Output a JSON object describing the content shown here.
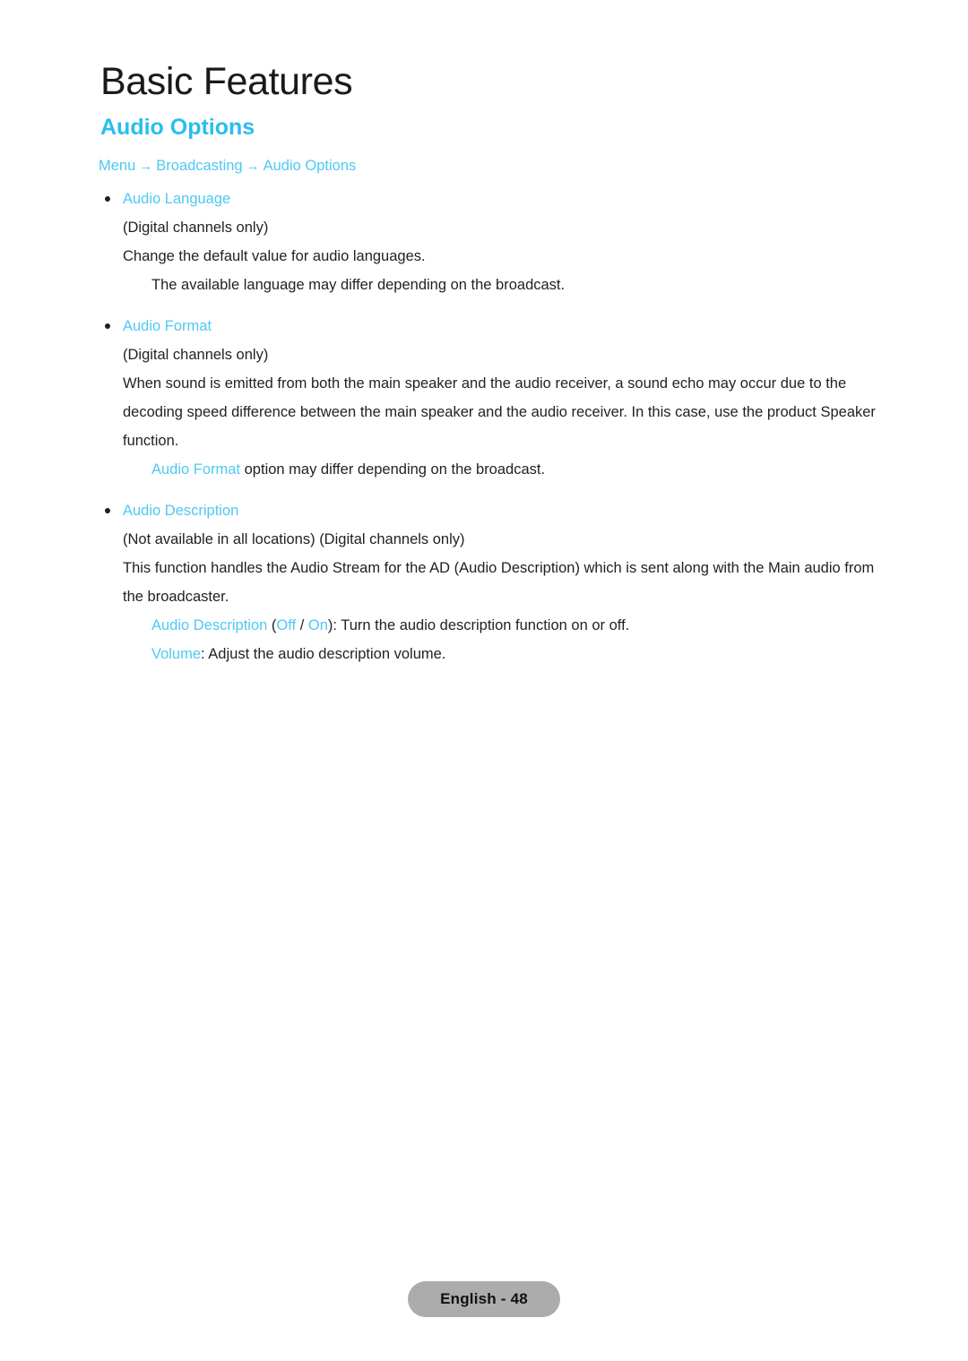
{
  "page": {
    "chapter_title": "Basic Features",
    "section_title": "Audio Options"
  },
  "breadcrumb": {
    "items": [
      "Menu",
      "Broadcasting",
      "Audio Options"
    ],
    "separator": "→"
  },
  "sections": [
    {
      "heading": "Audio Language",
      "lines": [
        {
          "style": "para",
          "text": "(Digital channels only)"
        },
        {
          "style": "para",
          "text": "Change the default value for audio languages."
        },
        {
          "style": "note",
          "text": "The available language may differ depending on the broadcast."
        }
      ]
    },
    {
      "heading": "Audio Format",
      "lines": [
        {
          "style": "para",
          "text": "(Digital channels only)"
        },
        {
          "style": "para",
          "text": "When sound is emitted from both the main speaker and the audio receiver, a sound echo may occur due to the decoding speed difference between the main speaker and the audio receiver. In this case, use the product Speaker function."
        },
        {
          "style": "note",
          "rich": true,
          "parts": [
            {
              "text": "Audio Format",
              "color": "cyan"
            },
            {
              "text": " option may differ depending on the broadcast.",
              "color": "dark"
            }
          ]
        }
      ]
    },
    {
      "heading": "Audio Description",
      "lines": [
        {
          "style": "para",
          "text": "(Not available in all locations) (Digital channels only)"
        },
        {
          "style": "para",
          "text": "This function handles the Audio Stream for the AD (Audio Description) which is sent along with the Main audio from the broadcaster."
        },
        {
          "style": "note",
          "rich": true,
          "parts": [
            {
              "text": "Audio Description",
              "color": "cyan"
            },
            {
              "text": " (",
              "color": "dark"
            },
            {
              "text": "Off",
              "color": "cyan"
            },
            {
              "text": " / ",
              "color": "dark"
            },
            {
              "text": "On",
              "color": "cyan"
            },
            {
              "text": "): Turn the audio description function on or off.",
              "color": "dark"
            }
          ]
        },
        {
          "style": "note",
          "rich": true,
          "parts": [
            {
              "text": "Volume",
              "color": "cyan"
            },
            {
              "text": ": Adjust the audio description volume.",
              "color": "dark"
            }
          ]
        }
      ]
    }
  ],
  "footer": {
    "page_label": "English - 48"
  },
  "colors": {
    "accent": "#29bdef",
    "link": "#4fc8f2",
    "body_text": "#231f20",
    "title_text": "#1a1a1a",
    "footer_pill_bg": "#acacac"
  }
}
